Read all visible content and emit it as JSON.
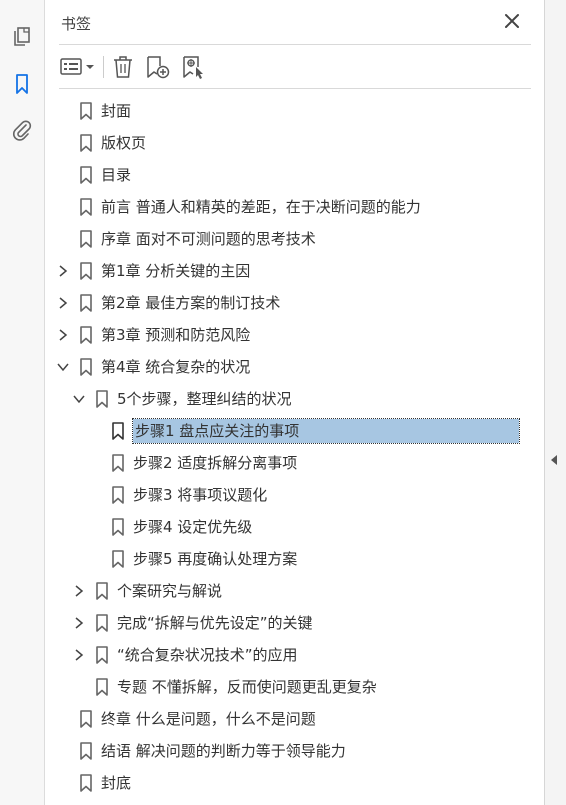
{
  "panel": {
    "title": "书签"
  },
  "tree": [
    {
      "label": "封面",
      "level": 0,
      "expander": "none",
      "selected": false
    },
    {
      "label": "版权页",
      "level": 0,
      "expander": "none",
      "selected": false
    },
    {
      "label": "目录",
      "level": 0,
      "expander": "none",
      "selected": false
    },
    {
      "label": "前言 普通人和精英的差距，在于决断问题的能力",
      "level": 0,
      "expander": "none",
      "selected": false
    },
    {
      "label": "序章 面对不可测问题的思考技术",
      "level": 0,
      "expander": "none",
      "selected": false
    },
    {
      "label": "第1章 分析关键的主因",
      "level": 0,
      "expander": "collapsed",
      "selected": false
    },
    {
      "label": "第2章 最佳方案的制订技术",
      "level": 0,
      "expander": "collapsed",
      "selected": false
    },
    {
      "label": "第3章 预测和防范风险",
      "level": 0,
      "expander": "collapsed",
      "selected": false
    },
    {
      "label": "第4章 统合复杂的状况",
      "level": 0,
      "expander": "expanded",
      "selected": false
    },
    {
      "label": "5个步骤，整理纠结的状况",
      "level": 1,
      "expander": "expanded",
      "selected": false
    },
    {
      "label": "步骤1 盘点应关注的事项",
      "level": 2,
      "expander": "none",
      "selected": true
    },
    {
      "label": "步骤2 适度拆解分离事项",
      "level": 2,
      "expander": "none",
      "selected": false
    },
    {
      "label": "步骤3 将事项议题化",
      "level": 2,
      "expander": "none",
      "selected": false
    },
    {
      "label": "步骤4 设定优先级",
      "level": 2,
      "expander": "none",
      "selected": false
    },
    {
      "label": "步骤5 再度确认处理方案",
      "level": 2,
      "expander": "none",
      "selected": false
    },
    {
      "label": "个案研究与解说",
      "level": 1,
      "expander": "collapsed",
      "selected": false
    },
    {
      "label": "完成“拆解与优先设定”的关键",
      "level": 1,
      "expander": "collapsed",
      "selected": false
    },
    {
      "label": "“统合复杂状况技术”的应用",
      "level": 1,
      "expander": "collapsed",
      "selected": false
    },
    {
      "label": "专题 不懂拆解，反而使问题更乱更复杂",
      "level": 1,
      "expander": "none",
      "selected": false
    },
    {
      "label": "终章 什么是问题，什么不是问题",
      "level": 0,
      "expander": "none",
      "selected": false
    },
    {
      "label": "结语 解决问题的判断力等于领导能力",
      "level": 0,
      "expander": "none",
      "selected": false
    },
    {
      "label": "封底",
      "level": 0,
      "expander": "none",
      "selected": false
    }
  ],
  "icons": {
    "rail": [
      "pages-icon",
      "bookmarks-icon",
      "attachments-icon"
    ],
    "toolbar": [
      "options-menu-icon",
      "delete-icon",
      "new-bookmark-icon",
      "new-bookmark-from-structure-icon"
    ]
  },
  "colors": {
    "accent": "#1473e6",
    "selection": "#a7c6e2"
  }
}
